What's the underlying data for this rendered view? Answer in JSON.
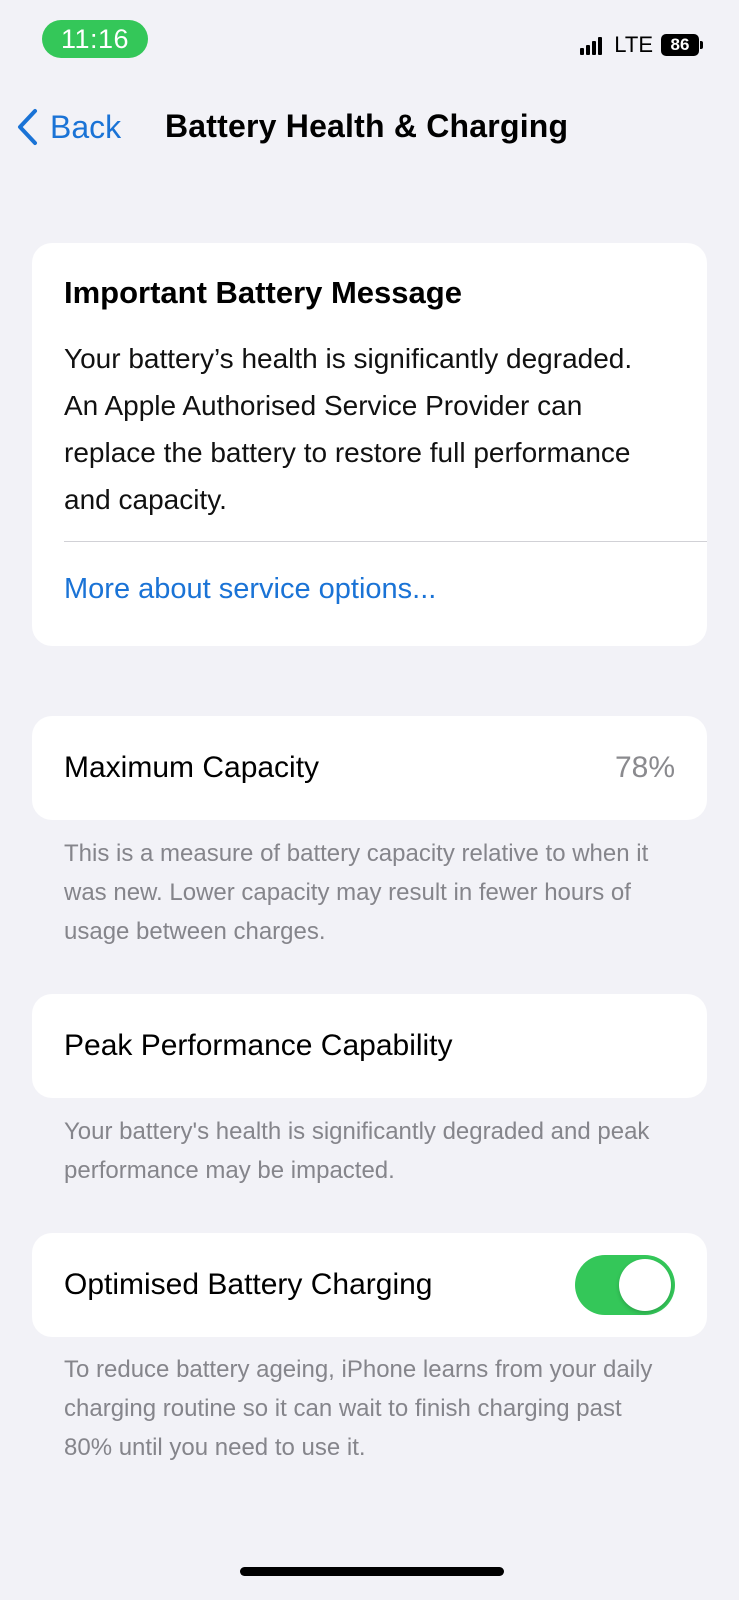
{
  "status_bar": {
    "time": "11:16",
    "network": "LTE",
    "battery_level": "86",
    "signal_icon": "cellular-signal-icon",
    "accent_color": "#34c759"
  },
  "nav": {
    "back_label": "Back",
    "back_icon": "chevron-left-icon",
    "title": "Battery Health & Charging",
    "tint_color": "#1a73d6"
  },
  "message_card": {
    "title": "Important Battery Message",
    "body": "Your battery’s health is significantly degraded. An Apple Authorised Service Provider can replace the battery to restore full performance and capacity.",
    "link": "More about service options..."
  },
  "capacity": {
    "label": "Maximum Capacity",
    "value": "78%",
    "footnote": "This is a measure of battery capacity relative to when it was new. Lower capacity may result in fewer hours of usage between charges."
  },
  "peak_performance": {
    "label": "Peak Performance Capability",
    "footnote": "Your battery's health is significantly degraded and peak performance may be impacted."
  },
  "optimised_charging": {
    "label": "Optimised Battery Charging",
    "enabled": true,
    "toggle_color": "#34c759",
    "footnote": "To reduce battery ageing, iPhone learns from your daily charging routine so it can wait to finish charging past 80% until you need to use it."
  }
}
